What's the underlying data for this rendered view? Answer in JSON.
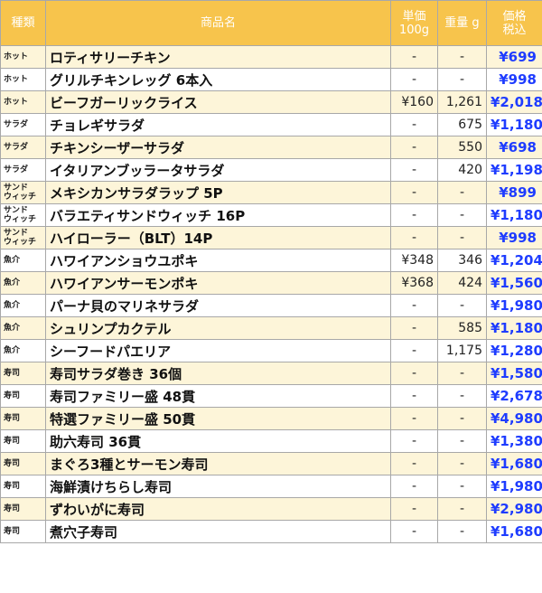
{
  "headers": {
    "category": "種類",
    "name": "商品名",
    "unit_price": "単価\n100g",
    "weight": "重量 g",
    "price": "価格\n税込"
  },
  "rows": [
    {
      "category": "ホット",
      "name": "ロティサリーチキン",
      "unit_price": "-",
      "weight": "-",
      "price": "¥699"
    },
    {
      "category": "ホット",
      "name": "グリルチキンレッグ 6本入",
      "unit_price": "-",
      "weight": "-",
      "price": "¥998"
    },
    {
      "category": "ホット",
      "name": "ビーフガーリックライス",
      "unit_price": "¥160",
      "weight": "1,261",
      "price": "¥2,018"
    },
    {
      "category": "サラダ",
      "name": "チョレギサラダ",
      "unit_price": "-",
      "weight": "675",
      "price": "¥1,180"
    },
    {
      "category": "サラダ",
      "name": "チキンシーザーサラダ",
      "unit_price": "-",
      "weight": "550",
      "price": "¥698"
    },
    {
      "category": "サラダ",
      "name": "イタリアンブッラータサラダ",
      "unit_price": "-",
      "weight": "420",
      "price": "¥1,198"
    },
    {
      "category": "サンド\nウィッチ",
      "name": "メキシカンサラダラップ 5P",
      "unit_price": "-",
      "weight": "-",
      "price": "¥899"
    },
    {
      "category": "サンド\nウィッチ",
      "name": "バラエティサンドウィッチ 16P",
      "unit_price": "-",
      "weight": "-",
      "price": "¥1,180"
    },
    {
      "category": "サンド\nウィッチ",
      "name": "ハイローラー（BLT）14P",
      "unit_price": "-",
      "weight": "-",
      "price": "¥998"
    },
    {
      "category": "魚介",
      "name": "ハワイアンショウユポキ",
      "unit_price": "¥348",
      "weight": "346",
      "price": "¥1,204"
    },
    {
      "category": "魚介",
      "name": "ハワイアンサーモンポキ",
      "unit_price": "¥368",
      "weight": "424",
      "price": "¥1,560"
    },
    {
      "category": "魚介",
      "name": "パーナ貝のマリネサラダ",
      "unit_price": "-",
      "weight": "-",
      "price": "¥1,980"
    },
    {
      "category": "魚介",
      "name": "シュリンプカクテル",
      "unit_price": "-",
      "weight": "585",
      "price": "¥1,180"
    },
    {
      "category": "魚介",
      "name": "シーフードパエリア",
      "unit_price": "-",
      "weight": "1,175",
      "price": "¥1,280"
    },
    {
      "category": "寿司",
      "name": "寿司サラダ巻き 36個",
      "unit_price": "-",
      "weight": "-",
      "price": "¥1,580"
    },
    {
      "category": "寿司",
      "name": "寿司ファミリー盛 48貫",
      "unit_price": "-",
      "weight": "-",
      "price": "¥2,678"
    },
    {
      "category": "寿司",
      "name": "特選ファミリー盛 50貫",
      "unit_price": "-",
      "weight": "-",
      "price": "¥4,980"
    },
    {
      "category": "寿司",
      "name": "助六寿司 36貫",
      "unit_price": "-",
      "weight": "-",
      "price": "¥1,380"
    },
    {
      "category": "寿司",
      "name": "まぐろ3種とサーモン寿司",
      "unit_price": "-",
      "weight": "-",
      "price": "¥1,680"
    },
    {
      "category": "寿司",
      "name": "海鮮漬けちらし寿司",
      "unit_price": "-",
      "weight": "-",
      "price": "¥1,980"
    },
    {
      "category": "寿司",
      "name": "ずわいがに寿司",
      "unit_price": "-",
      "weight": "-",
      "price": "¥2,980"
    },
    {
      "category": "寿司",
      "name": "煮穴子寿司",
      "unit_price": "-",
      "weight": "-",
      "price": "¥1,680"
    }
  ],
  "colors": {
    "header_bg": "#f7c44c",
    "stripe_bg": "#fdf5d9",
    "price_text": "#1e3cff"
  }
}
